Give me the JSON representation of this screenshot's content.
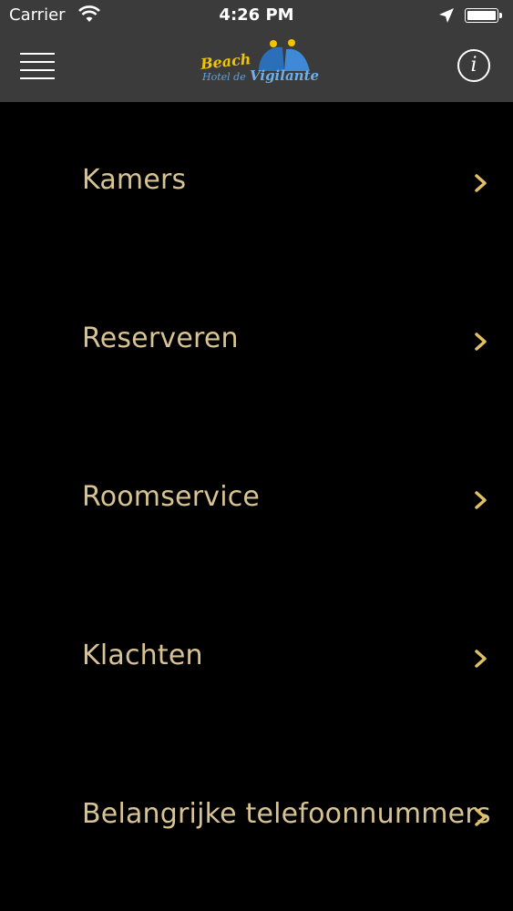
{
  "status_bar": {
    "carrier": "Carrier",
    "time": "4:26 PM"
  },
  "header": {
    "logo": {
      "line1": "Beach",
      "line2": "Hotel de",
      "line3": "Vigilante"
    },
    "info_icon": "i"
  },
  "menu": {
    "items": [
      {
        "label": "Kamers"
      },
      {
        "label": "Reserveren"
      },
      {
        "label": "Roomservice"
      },
      {
        "label": "Klachten"
      },
      {
        "label": "Belangrijke telefoonnummers"
      }
    ]
  },
  "colors": {
    "bar": "#3b3b3b",
    "background": "#000000",
    "label": "#d8c492",
    "chevron": "#e0c060"
  }
}
